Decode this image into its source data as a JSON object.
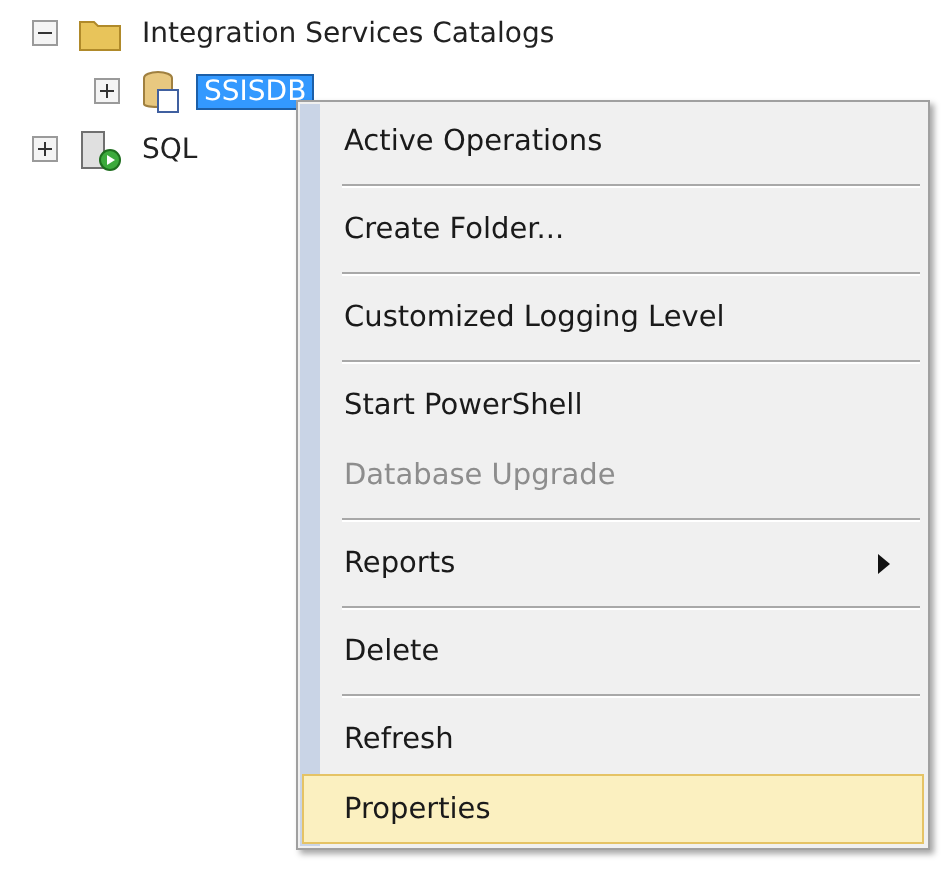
{
  "tree": [
    {
      "label": "Integration Services Catalogs",
      "expanded": true,
      "selected": false,
      "children": [
        {
          "label": "SSISDB",
          "expanded": false,
          "selected": true
        }
      ]
    },
    {
      "label": "SQL",
      "expanded": false,
      "selected": false
    }
  ],
  "context_menu": {
    "items": [
      {
        "kind": "item",
        "label": "Active Operations",
        "disabled": false,
        "selected": false,
        "submenu": false
      },
      {
        "kind": "separator"
      },
      {
        "kind": "item",
        "label": "Create Folder...",
        "disabled": false,
        "selected": false,
        "submenu": false
      },
      {
        "kind": "separator"
      },
      {
        "kind": "item",
        "label": "Customized Logging Level",
        "disabled": false,
        "selected": false,
        "submenu": false
      },
      {
        "kind": "separator"
      },
      {
        "kind": "item",
        "label": "Start PowerShell",
        "disabled": false,
        "selected": false,
        "submenu": false
      },
      {
        "kind": "item",
        "label": "Database Upgrade",
        "disabled": true,
        "selected": false,
        "submenu": false
      },
      {
        "kind": "separator"
      },
      {
        "kind": "item",
        "label": "Reports",
        "disabled": false,
        "selected": false,
        "submenu": true
      },
      {
        "kind": "separator"
      },
      {
        "kind": "item",
        "label": "Delete",
        "disabled": false,
        "selected": false,
        "submenu": false
      },
      {
        "kind": "separator"
      },
      {
        "kind": "item",
        "label": "Refresh",
        "disabled": false,
        "selected": false,
        "submenu": false
      },
      {
        "kind": "item",
        "label": "Properties",
        "disabled": false,
        "selected": true,
        "submenu": false
      }
    ]
  }
}
